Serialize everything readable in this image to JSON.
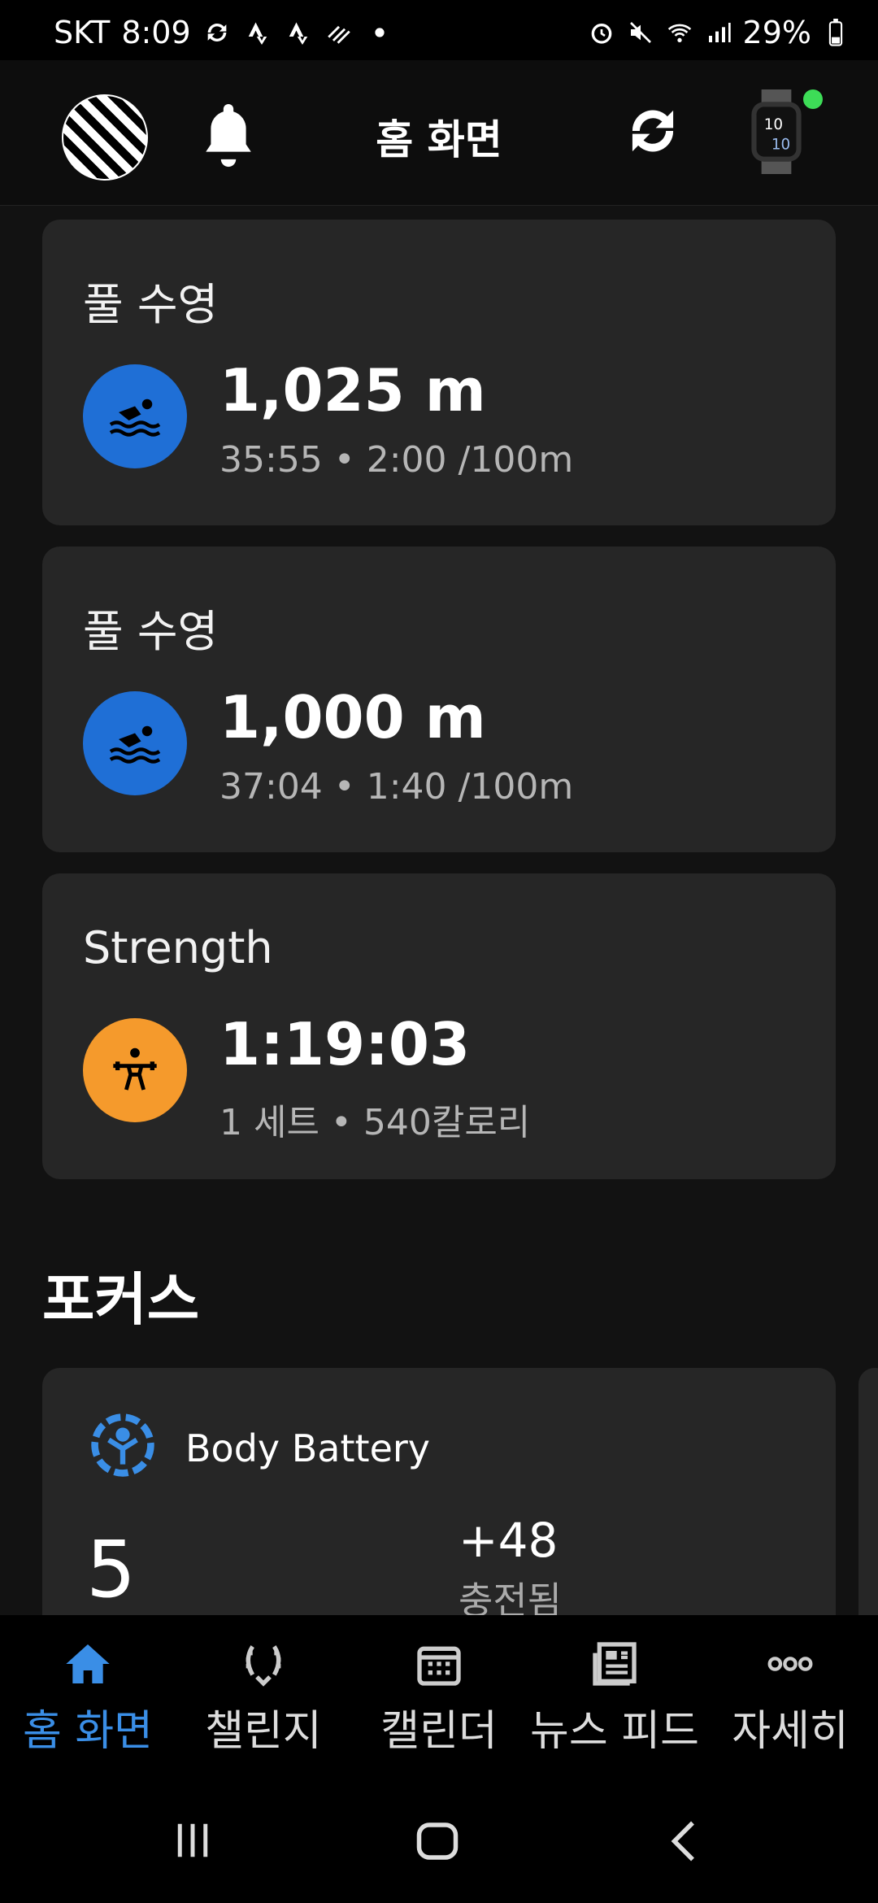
{
  "status_bar": {
    "carrier": "SKT",
    "time": "8:09",
    "battery": "29%",
    "left_icons": [
      "sync-icon",
      "strava-icon",
      "strava-icon",
      "dnd-icon",
      "dot-icon"
    ],
    "right_icons": [
      "alarm-icon",
      "mute-icon",
      "wifi-icon",
      "signal-icon",
      "battery-icon"
    ]
  },
  "app_bar": {
    "title": "홈 화면"
  },
  "cards": [
    {
      "title": "풀 수영",
      "value": "1,025 m",
      "sub": "35:55 • 2:00 /100m",
      "icon": "swim-icon",
      "color": "#1f6fd6"
    },
    {
      "title": "풀 수영",
      "value": "1,000 m",
      "sub": "37:04 • 1:40 /100m",
      "icon": "swim-icon",
      "color": "#1f6fd6"
    },
    {
      "title": "Strength",
      "value": "1:19:03",
      "sub": "1 세트 • 540칼로리",
      "icon": "weightlifting-icon",
      "color": "#f59a2c"
    }
  ],
  "focus": {
    "section_title": "포커스",
    "body_battery": {
      "title": "Body Battery",
      "value": "5",
      "delta": "+48",
      "delta_label": "충전됨"
    }
  },
  "bottom_nav": [
    {
      "label": "홈 화면",
      "icon": "home-icon",
      "active": true
    },
    {
      "label": "챌린지",
      "icon": "laurel-icon",
      "active": false
    },
    {
      "label": "캘린더",
      "icon": "calendar-icon",
      "active": false
    },
    {
      "label": "뉴스 피드",
      "icon": "newsfeed-icon",
      "active": false
    },
    {
      "label": "자세히",
      "icon": "more-icon",
      "active": false
    }
  ],
  "colors": {
    "accent": "#3a8ee6",
    "swim": "#1f6fd6",
    "strength": "#f59a2c",
    "card_bg": "#262626",
    "indicator": "#3ddc57"
  }
}
